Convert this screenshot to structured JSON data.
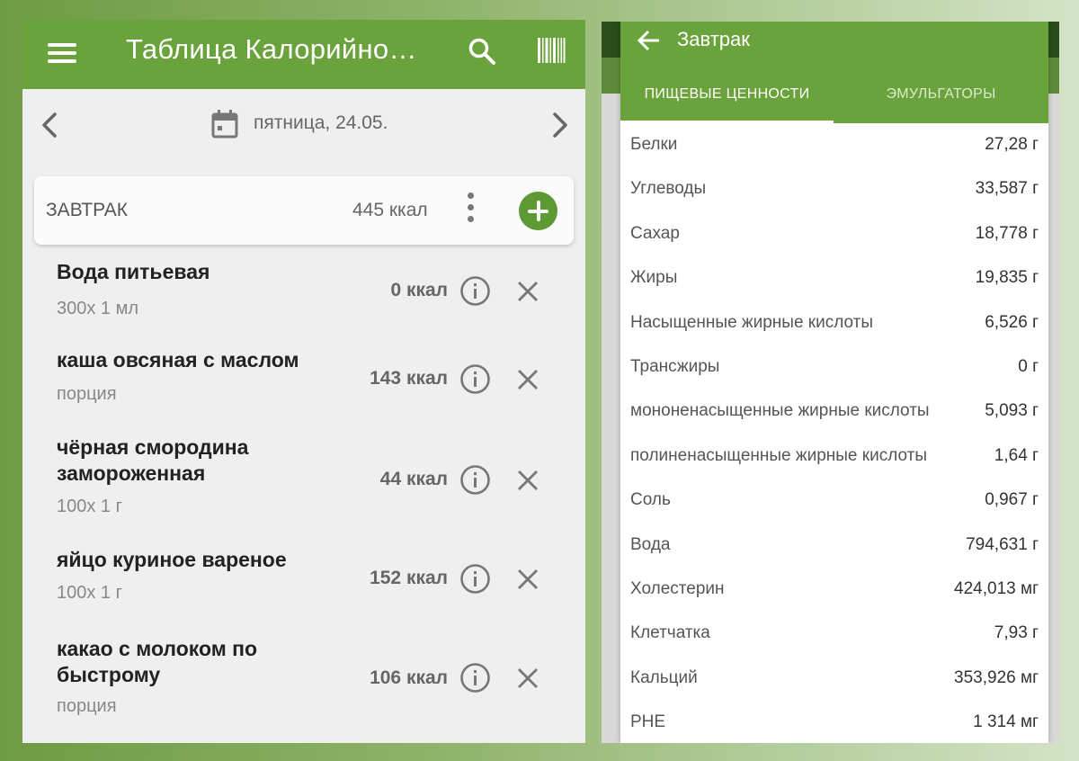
{
  "left_screen": {
    "app_bar": {
      "title": "Таблица Калорийно…"
    },
    "date_nav": {
      "date": "пятница, 24.05."
    },
    "meal": {
      "name": "ЗАВТРАК",
      "kcal": "445 ккал"
    },
    "foods": [
      {
        "name": "Вода питьевая",
        "portion": "300x 1 мл",
        "kcal": "0 ккал"
      },
      {
        "name": "каша овсяная с маслом",
        "portion": "порция",
        "kcal": "143 ккал"
      },
      {
        "name": "чёрная смородина замороженная",
        "portion": "100x 1 г",
        "kcal": "44 ккал"
      },
      {
        "name": "яйцо куриное вареное",
        "portion": "100x 1 г",
        "kcal": "152 ккал"
      },
      {
        "name": "какао с молоком по быстрому",
        "portion": "порция",
        "kcal": "106 ккал"
      }
    ],
    "icons": {
      "menu": "menu-icon",
      "search": "search-icon",
      "barcode": "barcode-icon",
      "calendar": "calendar-icon",
      "info": "info-icon",
      "remove": "close-icon",
      "add": "plus-icon",
      "more": "more-vert-icon"
    },
    "colors": {
      "accent": "#6aa33c",
      "add_button": "#5d9a34"
    }
  },
  "right_screen": {
    "dialog_title": "Завтрак",
    "tabs": [
      {
        "label": "ПИЩЕВЫЕ ЦЕННОСТИ",
        "active": true
      },
      {
        "label": "ЭМУЛЬГАТОРЫ",
        "active": false
      }
    ],
    "nutrients": [
      {
        "name": "Белки",
        "value": "27,28 г"
      },
      {
        "name": "Углеводы",
        "value": "33,587 г"
      },
      {
        "name": "Сахар",
        "value": "18,778 г"
      },
      {
        "name": "Жиры",
        "value": "19,835 г"
      },
      {
        "name": "Насыщенные жирные кислоты",
        "value": "6,526 г"
      },
      {
        "name": "Трансжиры",
        "value": "0 г"
      },
      {
        "name": "мононенасыщенные жирные кислоты",
        "value": "5,093 г"
      },
      {
        "name": "полиненасыщенные жирные кислоты",
        "value": "1,64 г"
      },
      {
        "name": "Соль",
        "value": "0,967 г"
      },
      {
        "name": "Вода",
        "value": "794,631 г"
      },
      {
        "name": "Холестерин",
        "value": "424,013 мг"
      },
      {
        "name": "Клетчатка",
        "value": "7,93 г"
      },
      {
        "name": "Кальций",
        "value": "353,926 мг"
      },
      {
        "name": "PHE",
        "value": "1 314 мг"
      }
    ]
  }
}
